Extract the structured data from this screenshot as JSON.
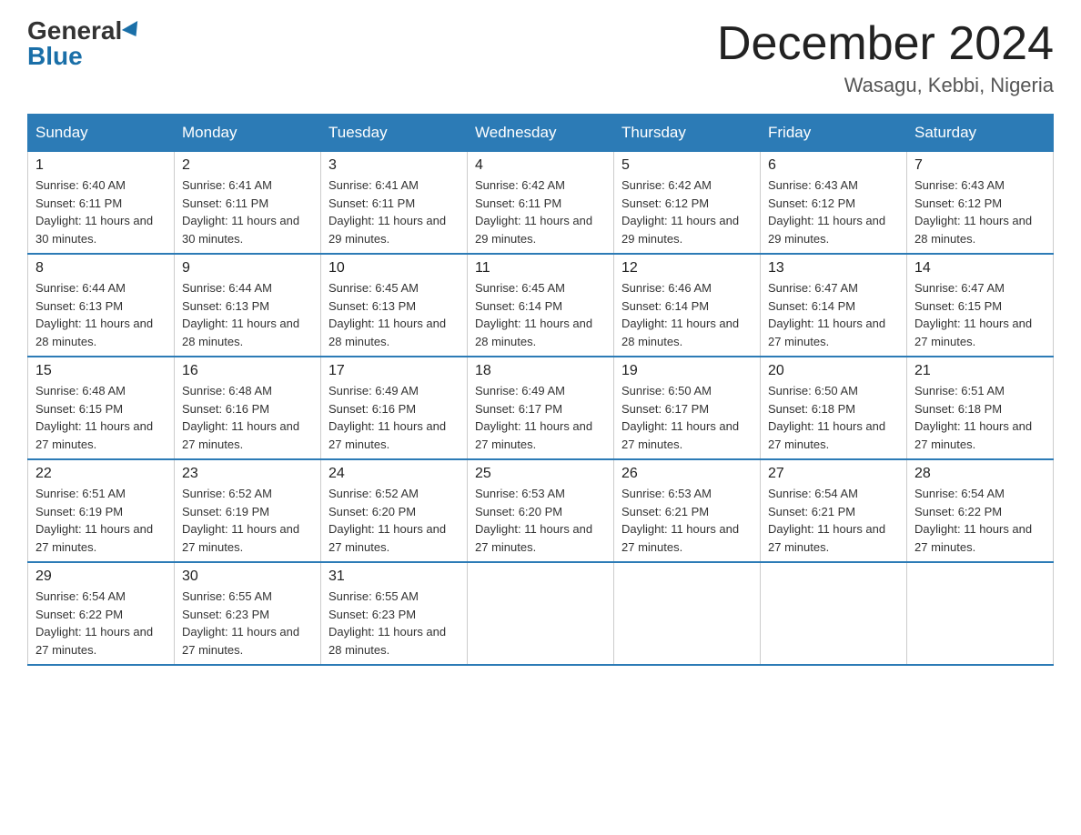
{
  "logo": {
    "general": "General",
    "blue": "Blue"
  },
  "header": {
    "month": "December 2024",
    "location": "Wasagu, Kebbi, Nigeria"
  },
  "days_of_week": [
    "Sunday",
    "Monday",
    "Tuesday",
    "Wednesday",
    "Thursday",
    "Friday",
    "Saturday"
  ],
  "weeks": [
    [
      {
        "day": "1",
        "sunrise": "6:40 AM",
        "sunset": "6:11 PM",
        "daylight": "11 hours and 30 minutes."
      },
      {
        "day": "2",
        "sunrise": "6:41 AM",
        "sunset": "6:11 PM",
        "daylight": "11 hours and 30 minutes."
      },
      {
        "day": "3",
        "sunrise": "6:41 AM",
        "sunset": "6:11 PM",
        "daylight": "11 hours and 29 minutes."
      },
      {
        "day": "4",
        "sunrise": "6:42 AM",
        "sunset": "6:11 PM",
        "daylight": "11 hours and 29 minutes."
      },
      {
        "day": "5",
        "sunrise": "6:42 AM",
        "sunset": "6:12 PM",
        "daylight": "11 hours and 29 minutes."
      },
      {
        "day": "6",
        "sunrise": "6:43 AM",
        "sunset": "6:12 PM",
        "daylight": "11 hours and 29 minutes."
      },
      {
        "day": "7",
        "sunrise": "6:43 AM",
        "sunset": "6:12 PM",
        "daylight": "11 hours and 28 minutes."
      }
    ],
    [
      {
        "day": "8",
        "sunrise": "6:44 AM",
        "sunset": "6:13 PM",
        "daylight": "11 hours and 28 minutes."
      },
      {
        "day": "9",
        "sunrise": "6:44 AM",
        "sunset": "6:13 PM",
        "daylight": "11 hours and 28 minutes."
      },
      {
        "day": "10",
        "sunrise": "6:45 AM",
        "sunset": "6:13 PM",
        "daylight": "11 hours and 28 minutes."
      },
      {
        "day": "11",
        "sunrise": "6:45 AM",
        "sunset": "6:14 PM",
        "daylight": "11 hours and 28 minutes."
      },
      {
        "day": "12",
        "sunrise": "6:46 AM",
        "sunset": "6:14 PM",
        "daylight": "11 hours and 28 minutes."
      },
      {
        "day": "13",
        "sunrise": "6:47 AM",
        "sunset": "6:14 PM",
        "daylight": "11 hours and 27 minutes."
      },
      {
        "day": "14",
        "sunrise": "6:47 AM",
        "sunset": "6:15 PM",
        "daylight": "11 hours and 27 minutes."
      }
    ],
    [
      {
        "day": "15",
        "sunrise": "6:48 AM",
        "sunset": "6:15 PM",
        "daylight": "11 hours and 27 minutes."
      },
      {
        "day": "16",
        "sunrise": "6:48 AM",
        "sunset": "6:16 PM",
        "daylight": "11 hours and 27 minutes."
      },
      {
        "day": "17",
        "sunrise": "6:49 AM",
        "sunset": "6:16 PM",
        "daylight": "11 hours and 27 minutes."
      },
      {
        "day": "18",
        "sunrise": "6:49 AM",
        "sunset": "6:17 PM",
        "daylight": "11 hours and 27 minutes."
      },
      {
        "day": "19",
        "sunrise": "6:50 AM",
        "sunset": "6:17 PM",
        "daylight": "11 hours and 27 minutes."
      },
      {
        "day": "20",
        "sunrise": "6:50 AM",
        "sunset": "6:18 PM",
        "daylight": "11 hours and 27 minutes."
      },
      {
        "day": "21",
        "sunrise": "6:51 AM",
        "sunset": "6:18 PM",
        "daylight": "11 hours and 27 minutes."
      }
    ],
    [
      {
        "day": "22",
        "sunrise": "6:51 AM",
        "sunset": "6:19 PM",
        "daylight": "11 hours and 27 minutes."
      },
      {
        "day": "23",
        "sunrise": "6:52 AM",
        "sunset": "6:19 PM",
        "daylight": "11 hours and 27 minutes."
      },
      {
        "day": "24",
        "sunrise": "6:52 AM",
        "sunset": "6:20 PM",
        "daylight": "11 hours and 27 minutes."
      },
      {
        "day": "25",
        "sunrise": "6:53 AM",
        "sunset": "6:20 PM",
        "daylight": "11 hours and 27 minutes."
      },
      {
        "day": "26",
        "sunrise": "6:53 AM",
        "sunset": "6:21 PM",
        "daylight": "11 hours and 27 minutes."
      },
      {
        "day": "27",
        "sunrise": "6:54 AM",
        "sunset": "6:21 PM",
        "daylight": "11 hours and 27 minutes."
      },
      {
        "day": "28",
        "sunrise": "6:54 AM",
        "sunset": "6:22 PM",
        "daylight": "11 hours and 27 minutes."
      }
    ],
    [
      {
        "day": "29",
        "sunrise": "6:54 AM",
        "sunset": "6:22 PM",
        "daylight": "11 hours and 27 minutes."
      },
      {
        "day": "30",
        "sunrise": "6:55 AM",
        "sunset": "6:23 PM",
        "daylight": "11 hours and 27 minutes."
      },
      {
        "day": "31",
        "sunrise": "6:55 AM",
        "sunset": "6:23 PM",
        "daylight": "11 hours and 28 minutes."
      },
      null,
      null,
      null,
      null
    ]
  ],
  "labels": {
    "sunrise": "Sunrise:",
    "sunset": "Sunset:",
    "daylight": "Daylight:"
  }
}
